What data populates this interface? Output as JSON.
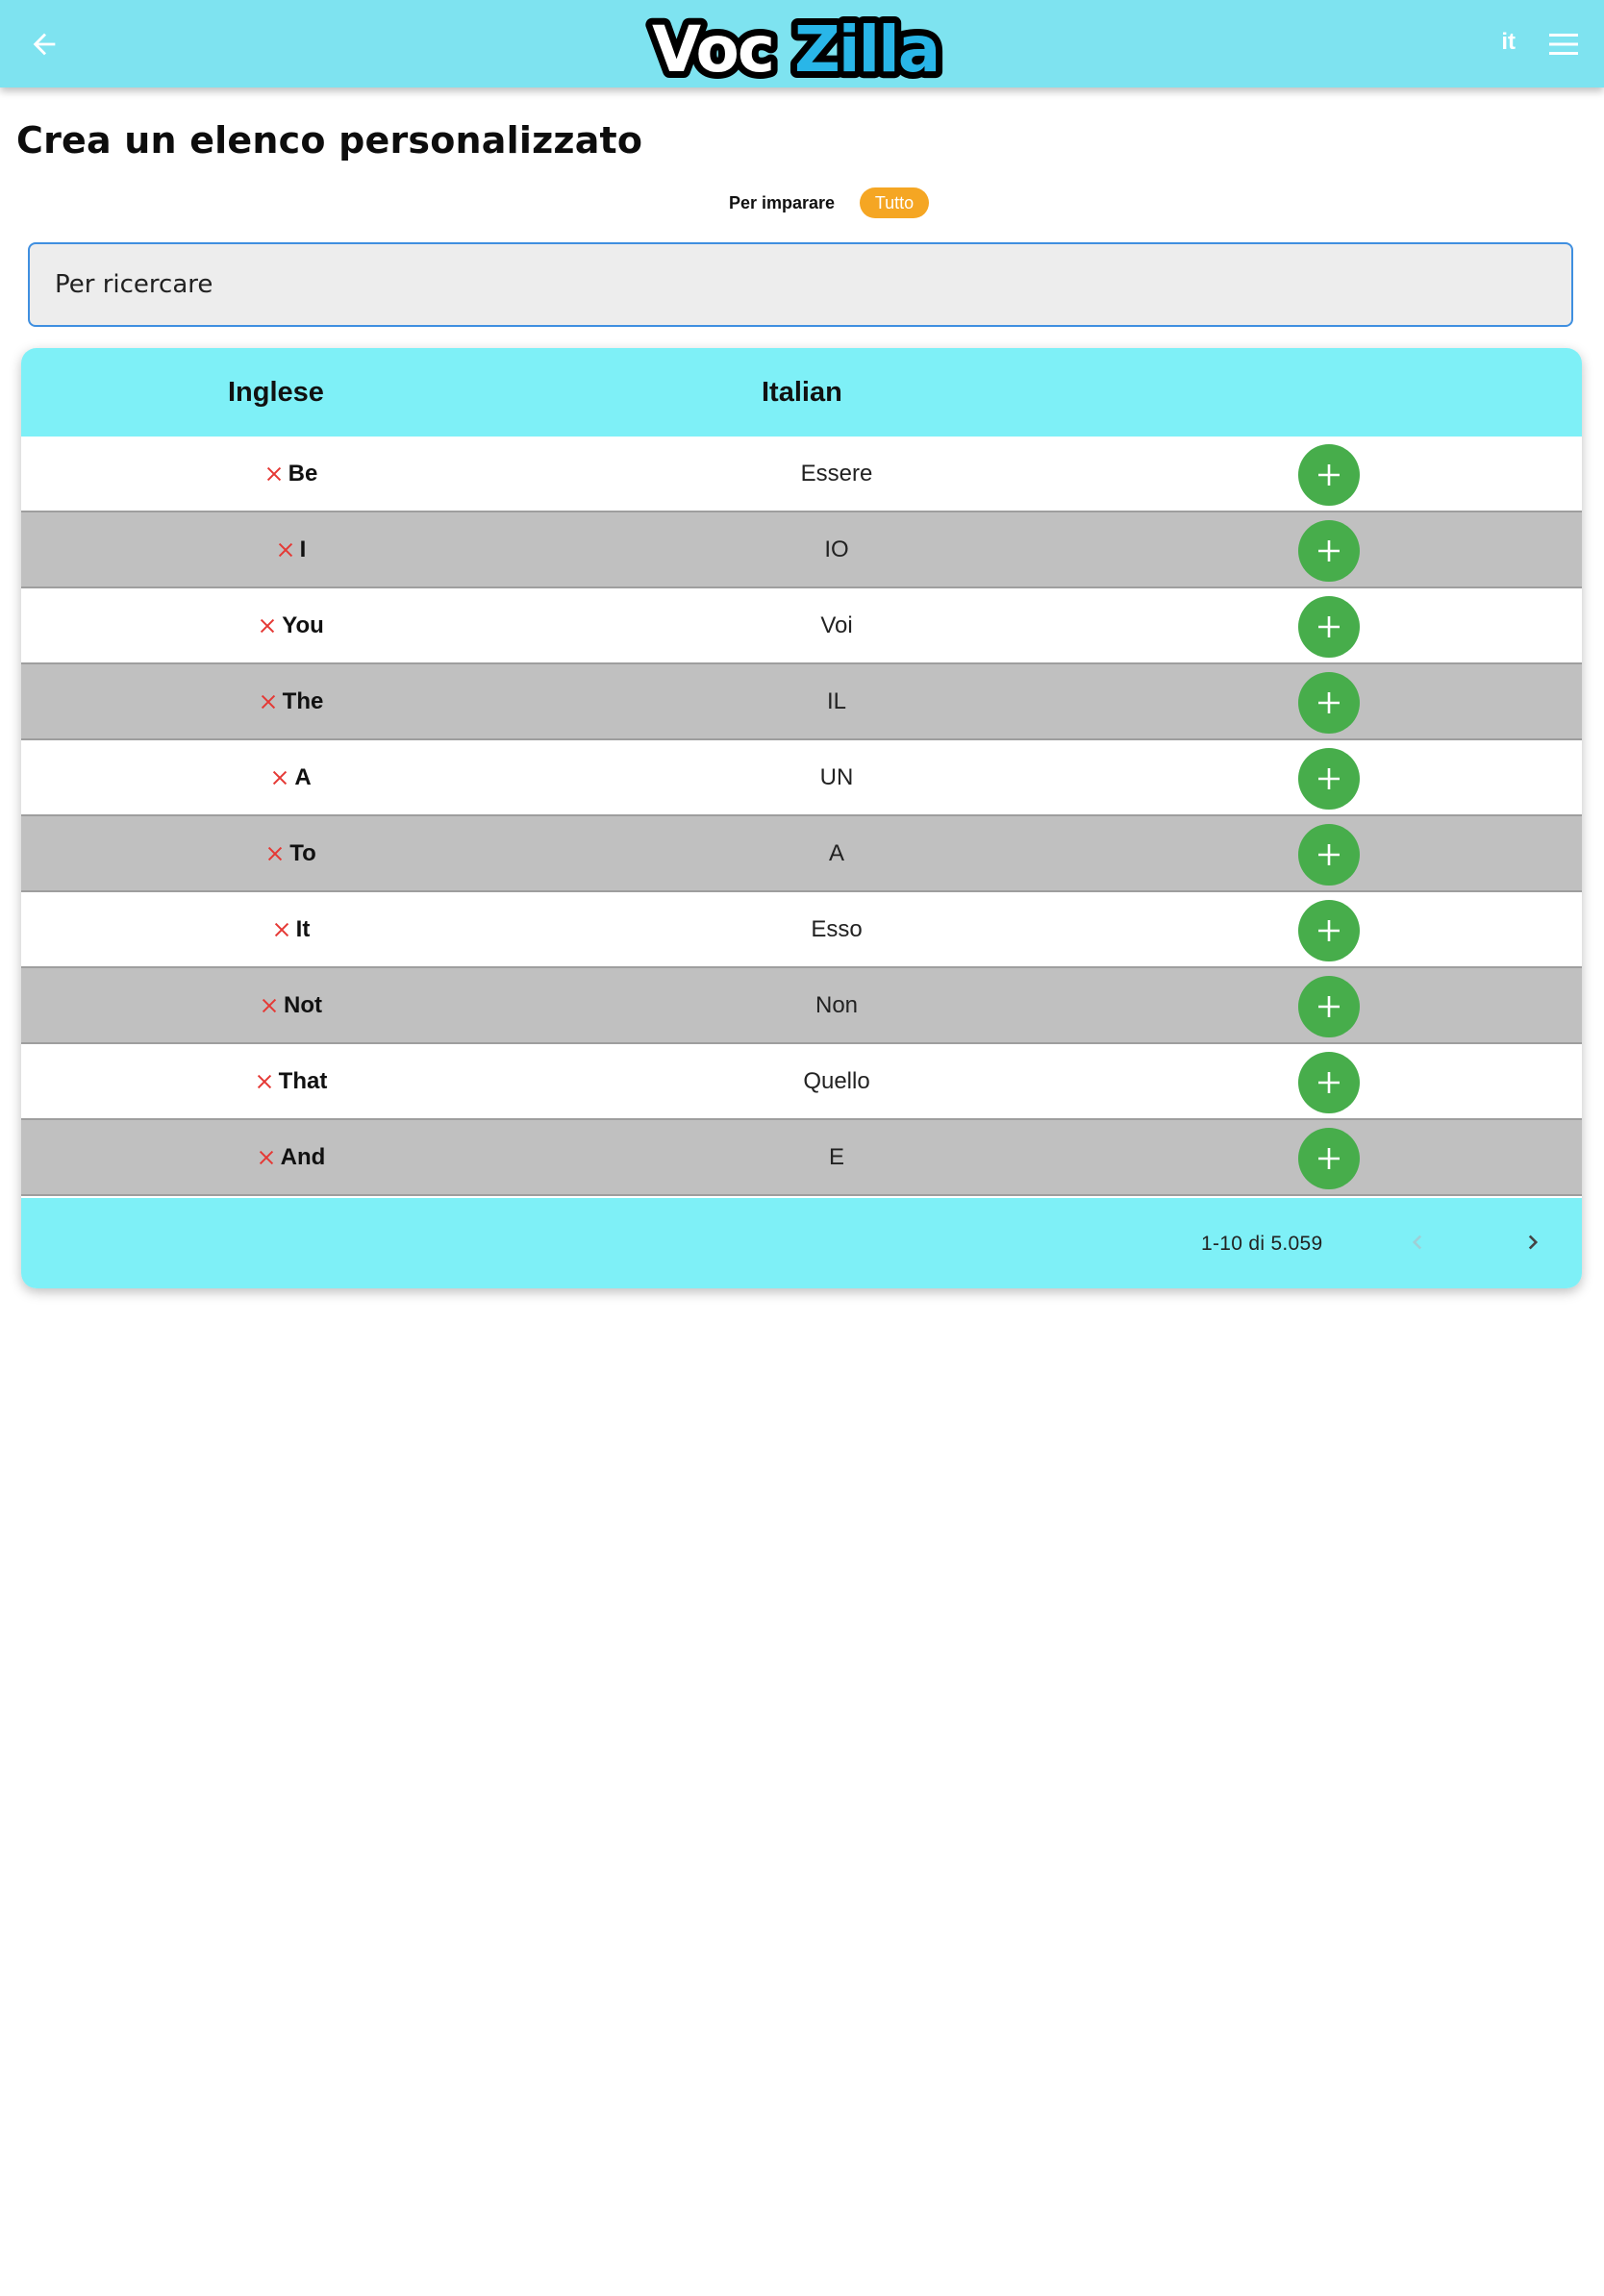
{
  "header": {
    "logo_text_part1": "Voc",
    "logo_text_part2": "Zilla",
    "language": "it",
    "back_icon": "arrow-left-icon",
    "menu_icon": "hamburger-menu-icon"
  },
  "page": {
    "title": "Crea un elenco personalizzato"
  },
  "filter": {
    "learn_label": "Per imparare",
    "all_label": "Tutto",
    "active": "Tutto"
  },
  "search": {
    "placeholder": "Per ricercare",
    "value": ""
  },
  "table": {
    "columns": [
      "Inglese",
      "Italian"
    ],
    "rows": [
      {
        "en": "Be",
        "it": "Essere"
      },
      {
        "en": "I",
        "it": "IO"
      },
      {
        "en": "You",
        "it": "Voi"
      },
      {
        "en": "The",
        "it": "IL"
      },
      {
        "en": "A",
        "it": "UN"
      },
      {
        "en": "To",
        "it": "A"
      },
      {
        "en": "It",
        "it": "Esso"
      },
      {
        "en": "Not",
        "it": "Non"
      },
      {
        "en": "That",
        "it": "Quello"
      },
      {
        "en": "And",
        "it": "E"
      }
    ]
  },
  "pagination": {
    "range_text": "1-10 di 5.059",
    "prev_icon": "chevron-left-icon",
    "next_icon": "chevron-right-icon"
  },
  "colors": {
    "header_bg": "#7ee3f0",
    "table_header_bg": "#7ef0f7",
    "accent_orange": "#f5a623",
    "add_green": "#47ad4b",
    "remove_red": "#e53935",
    "search_border": "#3f8fe0"
  }
}
